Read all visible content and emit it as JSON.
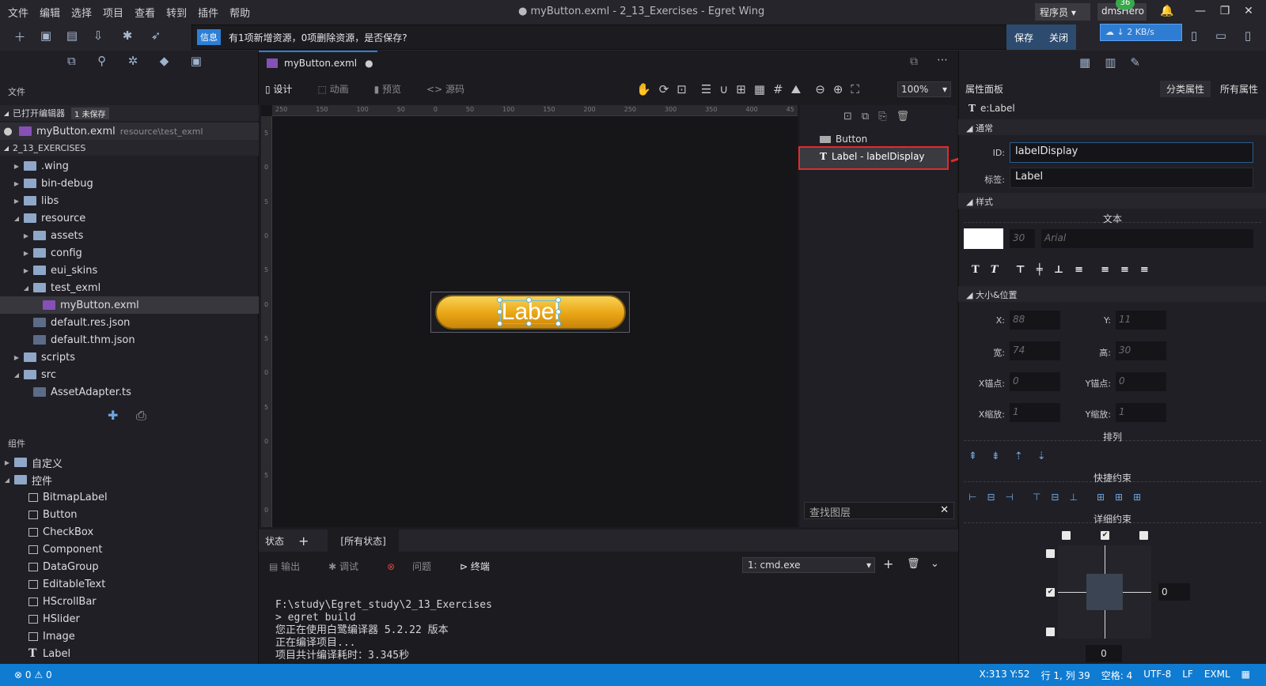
{
  "menu": [
    "文件",
    "编辑",
    "选择",
    "项目",
    "查看",
    "转到",
    "插件",
    "帮助"
  ],
  "window_title": "● myButton.exml - 2_13_Exercises - Egret Wing",
  "user": {
    "role": "程序员",
    "name": "dmsHero",
    "badge": "36",
    "net_speed": "↓ 2 KB/s"
  },
  "info": {
    "tag": "信息",
    "message": "有1项新增资源，0项删除资源，是否保存?",
    "save": "保存",
    "close": "关闭"
  },
  "left": {
    "files_title": "文件",
    "open_editors": "已打开编辑器",
    "unsaved": "1 未保存",
    "open_file": "myButton.exml",
    "open_file_path": "resource\\test_exml",
    "project": "2_13_EXERCISES",
    "tree": [
      ".wing",
      "bin-debug",
      "libs",
      "resource",
      "assets",
      "config",
      "eui_skins",
      "test_exml",
      "myButton.exml",
      "default.res.json",
      "default.thm.json",
      "scripts",
      "src",
      "AssetAdapter.ts"
    ],
    "components_title": "组件",
    "comp_groups": [
      "自定义",
      "控件"
    ],
    "components": [
      "BitmapLabel",
      "Button",
      "CheckBox",
      "Component",
      "DataGroup",
      "EditableText",
      "HScrollBar",
      "HSlider",
      "Image",
      "Label"
    ]
  },
  "editor": {
    "tab": "myButton.exml",
    "modes": [
      "设计",
      "动画",
      "预览",
      "源码"
    ],
    "zoom": "100%",
    "button_label": "Label",
    "ruler_ticks": [
      "250",
      "150",
      "100",
      "50",
      "0",
      "50",
      "100",
      "150",
      "200",
      "250",
      "300",
      "350",
      "400",
      "45"
    ],
    "ruler_v_ticks": [
      "5",
      "0",
      "5",
      "0",
      "5",
      "0",
      "5",
      "0",
      "5",
      "0",
      "5",
      "0"
    ]
  },
  "layers": {
    "items": [
      "Button",
      "Label - labelDisplay"
    ],
    "find": "查找图层"
  },
  "bottom": {
    "state": "状态",
    "all_states": "[所有状态]",
    "tabs": [
      "输出",
      "调试",
      "问题",
      "终端"
    ],
    "shell": "1: cmd.exe",
    "terminal": [
      "F:\\study\\Egret_study\\2_13_Exercises",
      "> egret build",
      "您正在使用白鹭编译器 5.2.22 版本",
      "正在编译项目...",
      "项目共计编译耗时：3.345秒"
    ]
  },
  "props": {
    "title": "属性面板",
    "tab_category": "分类属性",
    "tab_all": "所有属性",
    "element": "e:Label",
    "sec_common": "通常",
    "id_label": "ID:",
    "id_value": "labelDisplay",
    "tag_label": "标签:",
    "tag_value": "Label",
    "sec_style": "样式",
    "text_hdr": "文本",
    "font_size": "30",
    "font_name": "Arial",
    "sec_size": "大小&位置",
    "x_lbl": "X:",
    "x": "88",
    "y_lbl": "Y:",
    "y": "11",
    "w_lbl": "宽:",
    "w": "74",
    "h_lbl": "高:",
    "h": "30",
    "ax_lbl": "X锚点:",
    "ax": "0",
    "ay_lbl": "Y锚点:",
    "ay": "0",
    "sx_lbl": "X缩放:",
    "sx": "1",
    "sy_lbl": "Y缩放:",
    "sy": "1",
    "arrange_hdr": "排列",
    "quick_hdr": "快捷约束",
    "detail_hdr": "详细约束",
    "constraint_right": "0",
    "constraint_bottom": "0"
  },
  "status": {
    "errors": "0",
    "warnings": "0",
    "coords": "X:313 Y:52",
    "pos": "行 1, 列 39",
    "spaces": "空格: 4",
    "encoding": "UTF-8",
    "eol": "LF",
    "lang": "EXML"
  },
  "colors": {
    "accent": "#0f7bd1",
    "highlight": "#e32b2b",
    "button_gold": "#e9a514"
  }
}
